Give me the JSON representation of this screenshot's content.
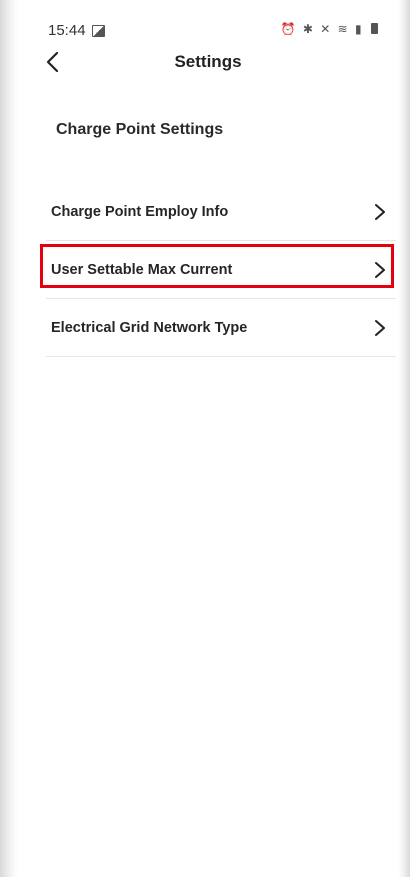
{
  "status_bar": {
    "time": "15:44",
    "icons": [
      "gallery-icon",
      "alarm-icon",
      "bluetooth-icon",
      "mute-icon",
      "wifi-icon",
      "signal-icon",
      "battery-icon"
    ]
  },
  "header": {
    "title": "Settings",
    "back_icon": "chevron-left-icon"
  },
  "section": {
    "title": "Charge Point Settings"
  },
  "menu": {
    "items": [
      {
        "label": "Charge Point Employ Info",
        "icon": "chevron-right-icon",
        "highlighted": false
      },
      {
        "label": "User Settable Max Current",
        "icon": "chevron-right-icon",
        "highlighted": true
      },
      {
        "label": "Electrical Grid Network Type",
        "icon": "chevron-right-icon",
        "highlighted": false
      }
    ]
  },
  "colors": {
    "highlight": "#e3000f",
    "text": "#262626",
    "divider": "#e6e6e6"
  }
}
